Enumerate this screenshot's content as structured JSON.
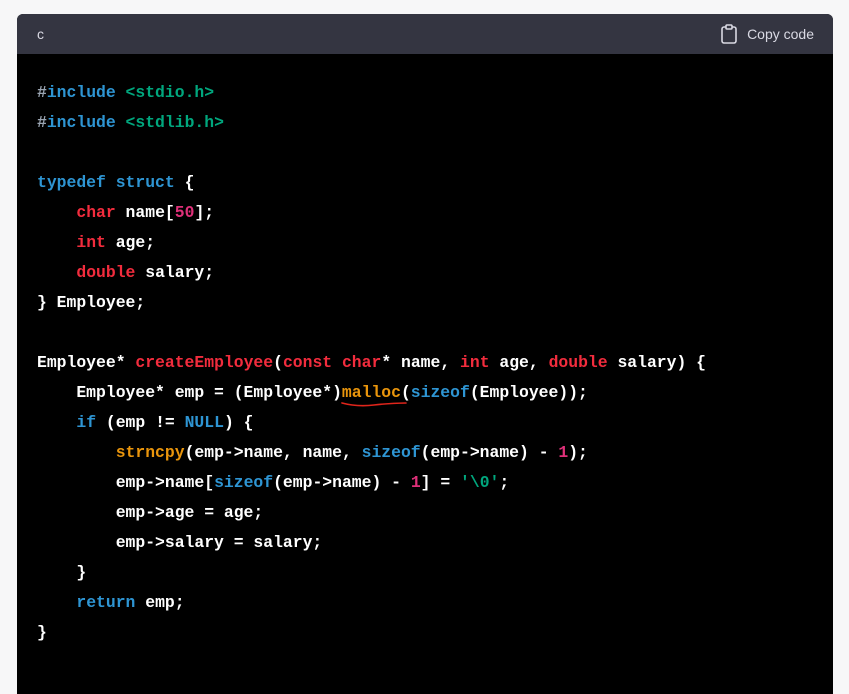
{
  "header": {
    "language": "c",
    "copy_label": "Copy code",
    "copy_icon": "clipboard-icon"
  },
  "colors": {
    "header_bg": "#343541",
    "code_bg": "#000000",
    "keyword": "#2e95d3",
    "type": "#f22c3d",
    "string": "#00a67d",
    "number": "#df3079",
    "function": "#e9950c",
    "squiggle": "#e1251b"
  },
  "lines": [
    [
      {
        "c": "pp",
        "t": "#"
      },
      {
        "c": "kw",
        "t": "include"
      },
      {
        "c": "plain",
        "t": " "
      },
      {
        "c": "str",
        "t": "<stdio.h>"
      }
    ],
    [
      {
        "c": "pp",
        "t": "#"
      },
      {
        "c": "kw",
        "t": "include"
      },
      {
        "c": "plain",
        "t": " "
      },
      {
        "c": "str",
        "t": "<stdlib.h>"
      }
    ],
    [],
    [
      {
        "c": "kw",
        "t": "typedef"
      },
      {
        "c": "plain",
        "t": " "
      },
      {
        "c": "kw",
        "t": "struct"
      },
      {
        "c": "plain",
        "t": " {"
      }
    ],
    [
      {
        "c": "plain",
        "t": "    "
      },
      {
        "c": "type",
        "t": "char"
      },
      {
        "c": "plain",
        "t": " name["
      },
      {
        "c": "num",
        "t": "50"
      },
      {
        "c": "plain",
        "t": "];"
      }
    ],
    [
      {
        "c": "plain",
        "t": "    "
      },
      {
        "c": "type",
        "t": "int"
      },
      {
        "c": "plain",
        "t": " age;"
      }
    ],
    [
      {
        "c": "plain",
        "t": "    "
      },
      {
        "c": "type",
        "t": "double"
      },
      {
        "c": "plain",
        "t": " salary;"
      }
    ],
    [
      {
        "c": "plain",
        "t": "} Employee;"
      }
    ],
    [],
    [
      {
        "c": "plain",
        "t": "Employee* "
      },
      {
        "c": "call",
        "t": "createEmployee"
      },
      {
        "c": "plain",
        "t": "("
      },
      {
        "c": "type",
        "t": "const"
      },
      {
        "c": "plain",
        "t": " "
      },
      {
        "c": "type",
        "t": "char"
      },
      {
        "c": "plain",
        "t": "* name, "
      },
      {
        "c": "type",
        "t": "int"
      },
      {
        "c": "plain",
        "t": " age, "
      },
      {
        "c": "type",
        "t": "double"
      },
      {
        "c": "plain",
        "t": " salary) {"
      }
    ],
    [
      {
        "c": "plain",
        "t": "    Employee* emp = (Employee*)"
      },
      {
        "c": "fn",
        "t": "malloc",
        "squiggle": true
      },
      {
        "c": "plain",
        "t": "("
      },
      {
        "c": "kw",
        "t": "sizeof"
      },
      {
        "c": "plain",
        "t": "(Employee));"
      }
    ],
    [
      {
        "c": "plain",
        "t": "    "
      },
      {
        "c": "kw",
        "t": "if"
      },
      {
        "c": "plain",
        "t": " (emp != "
      },
      {
        "c": "kw",
        "t": "NULL"
      },
      {
        "c": "plain",
        "t": ") {"
      }
    ],
    [
      {
        "c": "plain",
        "t": "        "
      },
      {
        "c": "fn",
        "t": "strncpy"
      },
      {
        "c": "plain",
        "t": "(emp->name, name, "
      },
      {
        "c": "kw",
        "t": "sizeof"
      },
      {
        "c": "plain",
        "t": "(emp->name) - "
      },
      {
        "c": "num",
        "t": "1"
      },
      {
        "c": "plain",
        "t": ");"
      }
    ],
    [
      {
        "c": "plain",
        "t": "        emp->name["
      },
      {
        "c": "kw",
        "t": "sizeof"
      },
      {
        "c": "plain",
        "t": "(emp->name) - "
      },
      {
        "c": "num",
        "t": "1"
      },
      {
        "c": "plain",
        "t": "] = "
      },
      {
        "c": "str",
        "t": "'\\0'"
      },
      {
        "c": "plain",
        "t": ";"
      }
    ],
    [
      {
        "c": "plain",
        "t": "        emp->age = age;"
      }
    ],
    [
      {
        "c": "plain",
        "t": "        emp->salary = salary;"
      }
    ],
    [
      {
        "c": "plain",
        "t": "    }"
      }
    ],
    [
      {
        "c": "plain",
        "t": "    "
      },
      {
        "c": "kw",
        "t": "return"
      },
      {
        "c": "plain",
        "t": " emp;"
      }
    ],
    [
      {
        "c": "plain",
        "t": "}"
      }
    ]
  ]
}
